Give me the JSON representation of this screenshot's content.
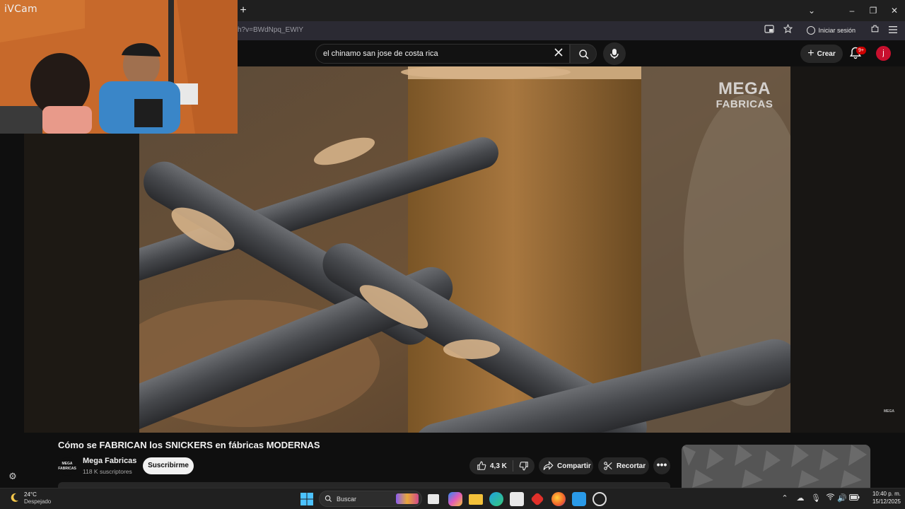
{
  "browser": {
    "url": "h?v=BWdNpq_EWIY",
    "signin_label": "Iniciar sesión",
    "new_tab_symbol": "+",
    "tab_list_symbol": "⌄",
    "window_controls": [
      "–",
      "❐",
      "✕"
    ]
  },
  "webcam": {
    "label": "iVCam"
  },
  "header": {
    "search_query": "el chinamo san jose de costa rica",
    "create_label": "Crear",
    "notification_badge": "9+",
    "user_initial": "j"
  },
  "video": {
    "watermark_line1": "MEGA",
    "watermark_line2": "FABRICAS",
    "corner_mark": "MEGA",
    "title": "Cómo se FABRICAN los SNICKERS en fábricas MODERNAS"
  },
  "channel": {
    "logo_text": "MEGA FABRICAS",
    "name": "Mega Fabricas",
    "subscribers": "118 K suscriptores",
    "subscribe_label": "Suscribirme"
  },
  "actions": {
    "like_count": "4,3 K",
    "share_label": "Compartir",
    "clip_label": "Recortar",
    "more_symbol": "•••"
  },
  "taskbar": {
    "weather_temp": "24°C",
    "weather_condition": "Despejado",
    "search_label": "Buscar",
    "time": "10:40 p. m.",
    "date": "15/12/2025"
  },
  "colors": {
    "accent_red": "#cc0000",
    "avatar_red": "#c8102e",
    "background": "#0f0f0f"
  }
}
